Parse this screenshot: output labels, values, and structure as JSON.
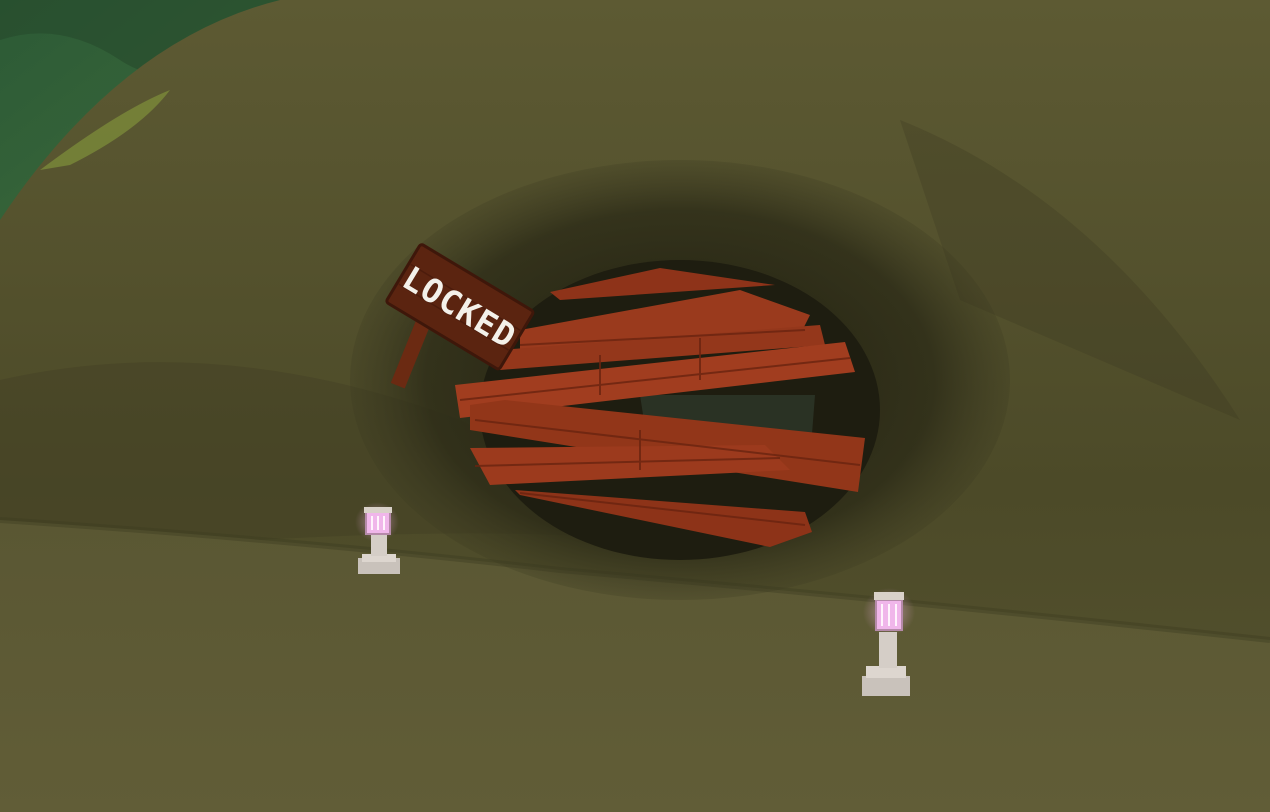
{
  "scene": {
    "description_type": "game-world-view",
    "sign": {
      "text": "LOCKED"
    },
    "colors": {
      "grass": "#5b5a33",
      "grass_dark": "#3f3d22",
      "planks": "#97381c",
      "planks_dark": "#6a2410",
      "sign_wood": "#5b2410",
      "lantern_glow": "#f2a7e6",
      "stone": "#d8d2cc",
      "distant_forest": "#2f5a35"
    },
    "icons": [
      "sign-icon",
      "lantern-icon",
      "lantern-icon"
    ]
  }
}
